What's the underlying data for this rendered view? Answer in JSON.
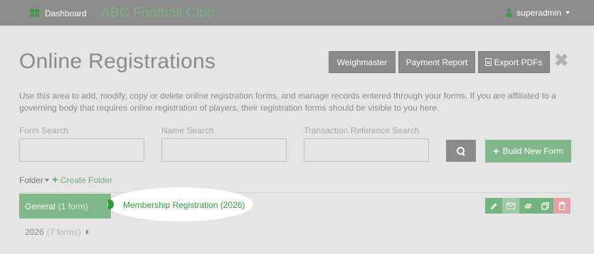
{
  "nav": {
    "dashboard_label": "Dashboard",
    "club_name": "ABC Football Club",
    "user_label": "superadmin"
  },
  "header": {
    "title": "Online Registrations",
    "buttons": {
      "weighmaster": "Weighmaster",
      "payment_report": "Payment Report",
      "export_pdfs": "Export PDFs"
    },
    "close_glyph": "✖"
  },
  "description": "Use this area to add, modify, copy or delete online registration forms, and manage records entered through your forms. If you are affiliated to a governing body that requires online registration of players, their registration forms should be visible to you here.",
  "search": {
    "form_search_label": "Form Search",
    "form_search_value": "",
    "name_search_label": "Name Search",
    "name_search_value": "",
    "txn_search_label": "Transaction Reference Search",
    "txn_search_value": ""
  },
  "build_new_form_label": "Build New Form",
  "folders": {
    "folder_label": "Folder",
    "create_folder_label": "Create Folder",
    "items": [
      {
        "name": "General",
        "count": "(1 form)"
      },
      {
        "name": "2026",
        "count": "(7 forms)"
      }
    ]
  },
  "forms": [
    {
      "name": "Membership Registration (2026)"
    }
  ],
  "colors": {
    "accent_green": "#2f9a3d",
    "button_green": "#7fb889",
    "delete_red": "#e6a2a7",
    "topbar": "#8c8c8c"
  },
  "icons": {
    "edit": "pencil-icon",
    "email": "envelope-icon",
    "link": "link-icon",
    "copy": "copy-icon",
    "delete": "trash-icon"
  }
}
